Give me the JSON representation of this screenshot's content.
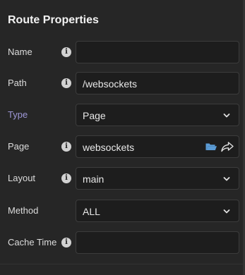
{
  "panel": {
    "title": "Route Properties"
  },
  "fields": {
    "name": {
      "label": "Name",
      "value": ""
    },
    "path": {
      "label": "Path",
      "value": "/websockets"
    },
    "type": {
      "label": "Type",
      "value": "Page",
      "accent_color": "#9d97d6"
    },
    "page": {
      "label": "Page",
      "value": "websockets",
      "icons": [
        "folder-icon",
        "share-arrow-icon"
      ],
      "folder_color": "#5b9bd5"
    },
    "layout": {
      "label": "Layout",
      "value": "main"
    },
    "method": {
      "label": "Method",
      "value": "ALL"
    },
    "cache_time": {
      "label": "Cache Time",
      "value": ""
    }
  },
  "info_icon": {
    "glyph": "i"
  }
}
